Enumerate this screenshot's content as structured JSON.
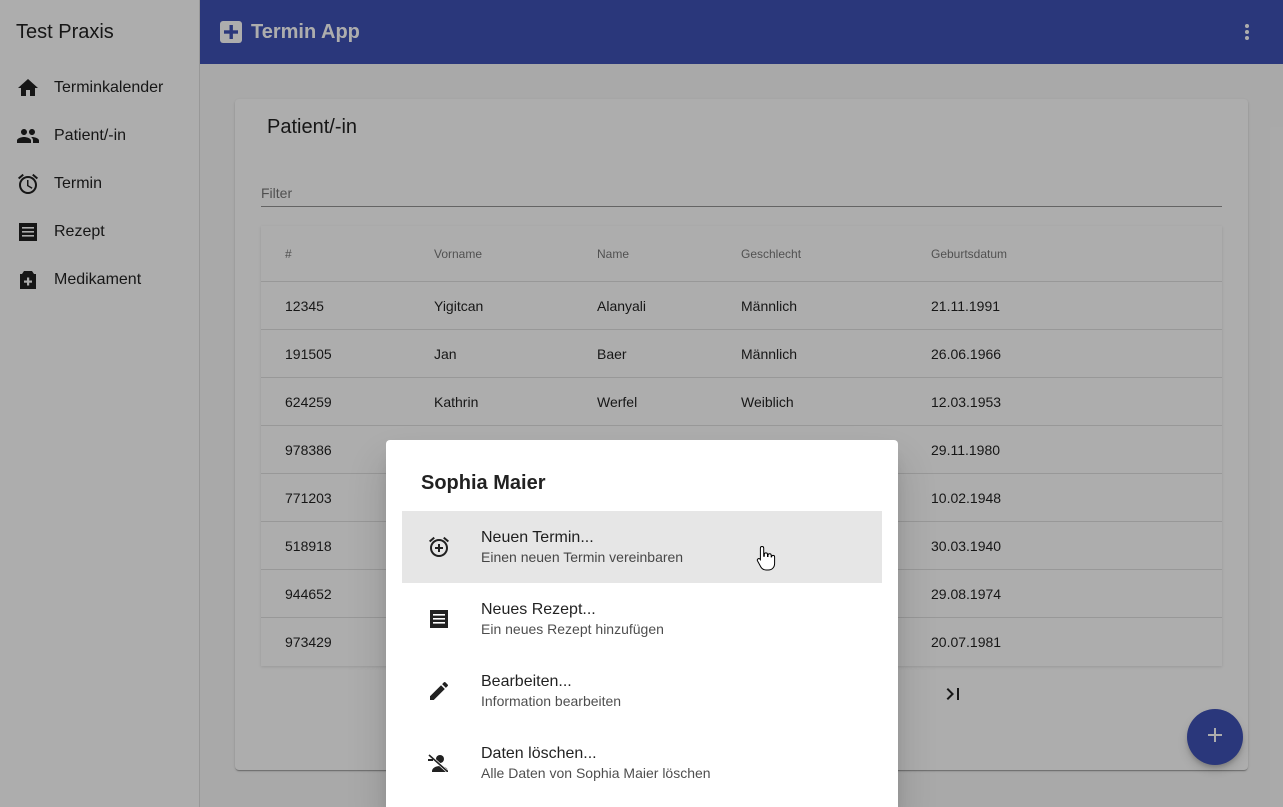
{
  "sidebar": {
    "title": "Test Praxis",
    "items": [
      {
        "label": "Terminkalender",
        "icon": "home-icon"
      },
      {
        "label": "Patient/-in",
        "icon": "people-icon"
      },
      {
        "label": "Termin",
        "icon": "alarm-icon"
      },
      {
        "label": "Rezept",
        "icon": "receipt-icon"
      },
      {
        "label": "Medikament",
        "icon": "medication-icon"
      }
    ]
  },
  "toolbar": {
    "title": "Termin App",
    "color": "#3f51b5"
  },
  "card": {
    "title": "Patient/-in",
    "filter_placeholder": "Filter"
  },
  "table": {
    "columns": [
      "#",
      "Vorname",
      "Name",
      "Geschlecht",
      "Geburtsdatum"
    ],
    "rows": [
      [
        "12345",
        "Yigitcan",
        "Alanyali",
        "Männlich",
        "21.11.1991"
      ],
      [
        "191505",
        "Jan",
        "Baer",
        "Männlich",
        "26.06.1966"
      ],
      [
        "624259",
        "Kathrin",
        "Werfel",
        "Weiblich",
        "12.03.1953"
      ],
      [
        "978386",
        "",
        "",
        "",
        "29.11.1980"
      ],
      [
        "771203",
        "",
        "",
        "",
        "10.02.1948"
      ],
      [
        "518918",
        "",
        "",
        "",
        "30.03.1940"
      ],
      [
        "944652",
        "",
        "",
        "",
        "29.08.1974"
      ],
      [
        "973429",
        "",
        "",
        "",
        "20.07.1981"
      ]
    ]
  },
  "dialog": {
    "title": "Sophia Maier",
    "actions": [
      {
        "label": "Neuen Termin...",
        "sub": "Einen neuen Termin vereinbaren",
        "icon": "add-alarm-icon"
      },
      {
        "label": "Neues Rezept...",
        "sub": "Ein neues Rezept hinzufügen",
        "icon": "receipt-icon"
      },
      {
        "label": "Bearbeiten...",
        "sub": "Information bearbeiten",
        "icon": "edit-pencil-icon"
      },
      {
        "label": "Daten löschen...",
        "sub": "Alle Daten von Sophia Maier löschen",
        "icon": "person-remove-icon"
      }
    ]
  }
}
